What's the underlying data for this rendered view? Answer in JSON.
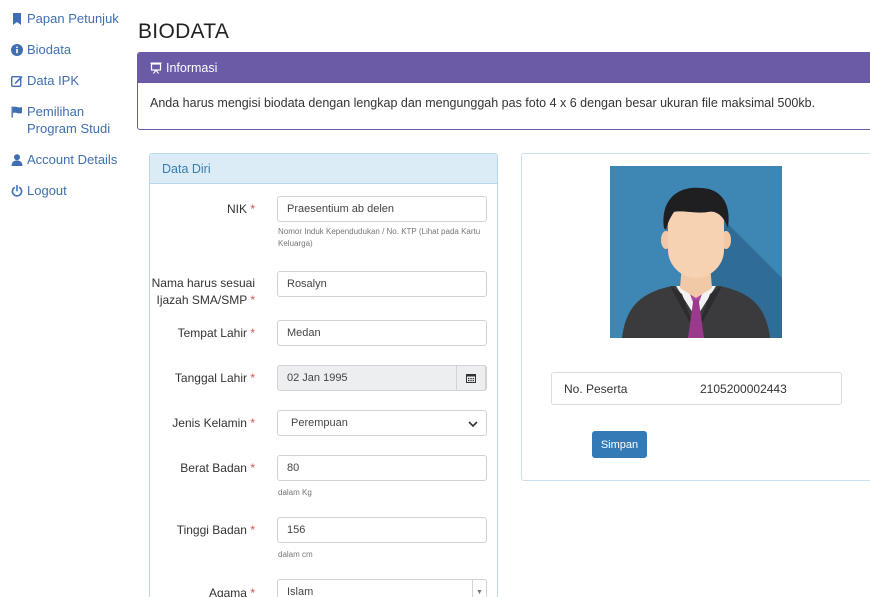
{
  "sidebar": {
    "items": [
      {
        "label": "Papan Petunjuk",
        "icon": "bookmark-icon"
      },
      {
        "label": "Biodata",
        "icon": "info-circle-icon"
      },
      {
        "label": "Data IPK",
        "icon": "edit-icon"
      },
      {
        "label": "Pemilihan Program Studi",
        "icon": "flag-icon"
      },
      {
        "label": "Account Details",
        "icon": "user-icon"
      },
      {
        "label": "Logout",
        "icon": "power-icon"
      }
    ]
  },
  "page": {
    "title": "BIODATA"
  },
  "info": {
    "title": "Informasi",
    "text": "Anda harus mengisi biodata dengan lengkap dan mengunggah pas foto 4 x 6 dengan besar ukuran file maksimal 500kb."
  },
  "form": {
    "title": "Data Diri",
    "required_mark": "*",
    "nik": {
      "label": "NIK",
      "value": "Praesentium ab delen",
      "help": "Nomor Induk Kependudukan / No. KTP (Lihat pada Kartu Keluarga)"
    },
    "nama": {
      "label": "Nama harus sesuai Ijazah SMA/SMP",
      "value": "Rosalyn"
    },
    "tempat_lahir": {
      "label": "Tempat Lahir",
      "value": "Medan"
    },
    "tanggal_lahir": {
      "label": "Tanggal Lahir",
      "value": "02 Jan 1995"
    },
    "jenis_kelamin": {
      "label": "Jenis Kelamin",
      "value": "Perempuan"
    },
    "berat_badan": {
      "label": "Berat Badan",
      "value": "80",
      "help": "dalam Kg"
    },
    "tinggi_badan": {
      "label": "Tinggi Badan",
      "value": "156",
      "help": "dalam cm"
    },
    "agama": {
      "label": "Agama",
      "value": "Islam"
    }
  },
  "profile": {
    "peserta_label": "No. Peserta",
    "peserta_value": "2105200002443",
    "save_label": "Simpan"
  },
  "colors": {
    "link": "#3f6fb0",
    "info_header": "#6b5aa6",
    "panel_header": "#dcecf7",
    "primary_button": "#337ab7",
    "required": "#d9534f"
  }
}
